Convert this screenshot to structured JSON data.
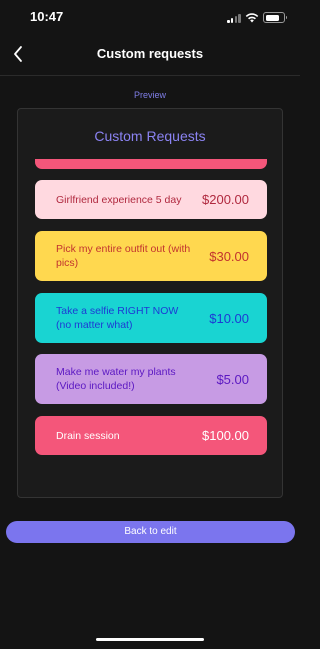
{
  "status_bar": {
    "time": "10:47"
  },
  "header": {
    "title": "Custom requests"
  },
  "preview": {
    "label": "Preview",
    "card_title": "Custom Requests",
    "items": [
      {
        "description": "Girlfriend experience 5 day",
        "price": "$200.00",
        "bg": "#ffd9e0",
        "text_color": "#b0293f",
        "price_color": "#b0293f"
      },
      {
        "description": "Pick my entire outfit out (with pics)",
        "price": "$30.00",
        "bg": "#ffd84f",
        "text_color": "#c2342f",
        "price_color": "#c2342f"
      },
      {
        "description": "Take a selfie RIGHT NOW (no matter what)",
        "price": "$10.00",
        "bg": "#19d4d2",
        "text_color": "#1d3ad4",
        "price_color": "#1d3ad4"
      },
      {
        "description": "Make me water my plants (Video included!)",
        "price": "$5.00",
        "bg": "#c79be4",
        "text_color": "#5b18c2",
        "price_color": "#5b18c2"
      },
      {
        "description": "Drain session",
        "price": "$100.00",
        "bg": "#f4567a",
        "text_color": "#ffffff",
        "price_color": "#ffffff"
      }
    ]
  },
  "actions": {
    "back_to_edit_label": "Back to edit"
  },
  "colors": {
    "accent": "#7b75ee",
    "background": "#141414"
  }
}
